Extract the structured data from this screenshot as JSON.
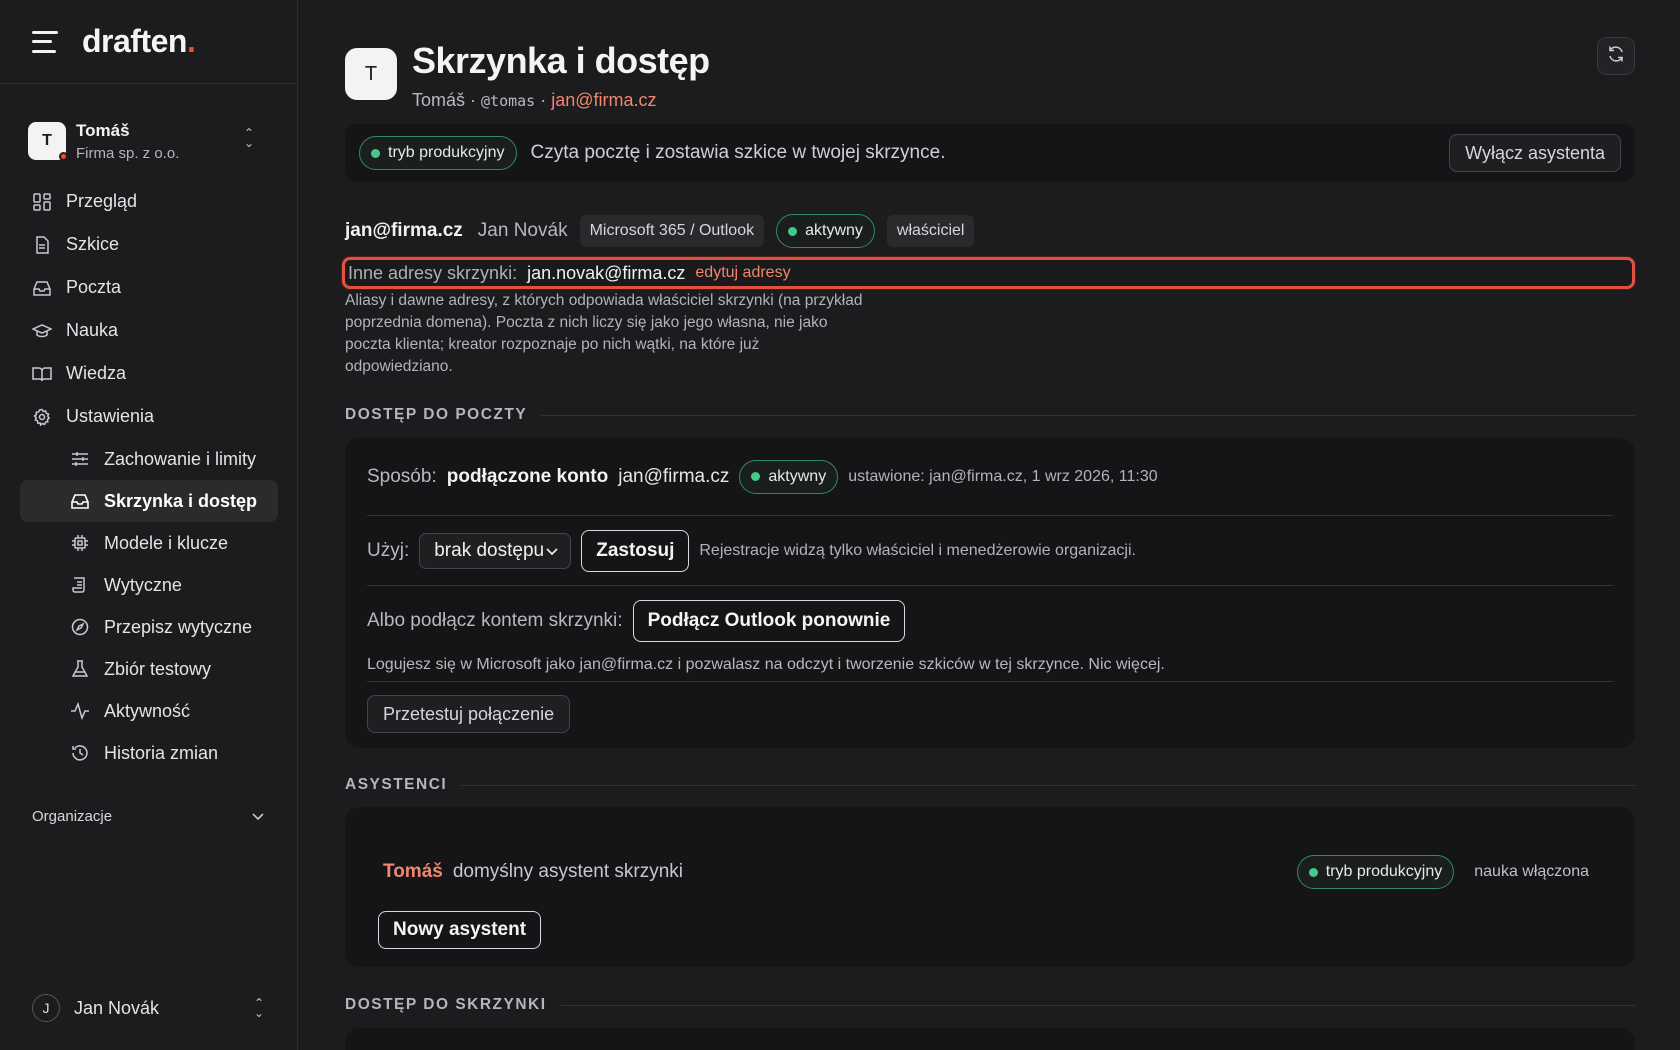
{
  "brand": {
    "name": "draften",
    "dot": "."
  },
  "org": {
    "initial": "T",
    "name": "Tomáš",
    "company": "Firma sp. z o.o."
  },
  "nav": [
    {
      "label": "Przegląd",
      "icon": "grid-icon"
    },
    {
      "label": "Szkice",
      "icon": "file-icon"
    },
    {
      "label": "Poczta",
      "icon": "inbox-icon"
    },
    {
      "label": "Nauka",
      "icon": "graduation-cap-icon"
    },
    {
      "label": "Wiedza",
      "icon": "book-icon"
    },
    {
      "label": "Ustawienia",
      "icon": "gear-icon"
    }
  ],
  "subnav": [
    {
      "label": "Zachowanie i limity",
      "icon": "sliders-icon"
    },
    {
      "label": "Skrzynka i dostęp",
      "icon": "inbox-icon",
      "active": true
    },
    {
      "label": "Modele i klucze",
      "icon": "chip-icon"
    },
    {
      "label": "Wytyczne",
      "icon": "scroll-icon"
    },
    {
      "label": "Przepisz wytyczne",
      "icon": "compass-icon"
    },
    {
      "label": "Zbiór testowy",
      "icon": "flask-icon"
    },
    {
      "label": "Aktywność",
      "icon": "activity-icon"
    },
    {
      "label": "Historia zmian",
      "icon": "history-icon"
    }
  ],
  "org_section": {
    "label": "Organizacje"
  },
  "user": {
    "initial": "J",
    "name": "Jan Novák"
  },
  "header": {
    "initial": "T",
    "title": "Skrzynka i dostęp",
    "name": "Tomáš",
    "sep": " · ",
    "handle": "@tomas",
    "email": "jan@firma.cz"
  },
  "mode": {
    "pill": "tryb produkcyjny",
    "description": "Czyta pocztę i zostawia szkice w twojej skrzynce.",
    "button": "Wyłącz asystenta"
  },
  "mailbox": {
    "email": "jan@firma.cz",
    "owner": "Jan Novák",
    "provider": "Microsoft 365 / Outlook",
    "status": "aktywny",
    "role": "właściciel",
    "aliases_label": "Inne adresy skrzynki:",
    "aliases_value": "jan.novak@firma.cz",
    "aliases_edit": "edytuj adresy",
    "aliases_help": "Aliasy i dawne adresy, z których odpowiada właściciel skrzynki (na przykład poprzednia domena). Poczta z nich liczy się jako jego własna, nie jako poczta klienta; kreator rozpoznaje po nich wątki, na które już odpowiedziano."
  },
  "access": {
    "section_title": "DOSTĘP DO POCZTY",
    "method_label": "Sposób:",
    "method_value": "podłączone konto",
    "method_email": "jan@firma.cz",
    "status": "aktywny",
    "set_info": "ustawione: jan@firma.cz, 1 wrz 2026, 11:30",
    "use_label": "Użyj:",
    "use_value": "brak dostępu",
    "apply": "Zastosuj",
    "use_note": "Rejestracje widzą tylko właściciel i menedżerowie organizacji.",
    "connect_label": "Albo podłącz kontem skrzynki:",
    "connect_button": "Podłącz Outlook ponownie",
    "connect_note": "Logujesz się w Microsoft jako jan@firma.cz i pozwalasz na odczyt i tworzenie szkiców w tej skrzynce. Nic więcej.",
    "test_button": "Przetestuj połączenie"
  },
  "assistants": {
    "section_title": "ASYSTENCI",
    "name": "Tomáš",
    "description": "domyślny asystent skrzynki",
    "mode": "tryb produkcyjny",
    "learning": "nauka włączona",
    "new_button": "Nowy asystent"
  },
  "mailbox_access": {
    "section_title": "DOSTĘP DO SKRZYNKI"
  },
  "colors": {
    "accent": "#f0866e",
    "brand_dot": "#ef4b3a",
    "status_green": "#45c98f",
    "focus_ring": "#e0523f"
  }
}
